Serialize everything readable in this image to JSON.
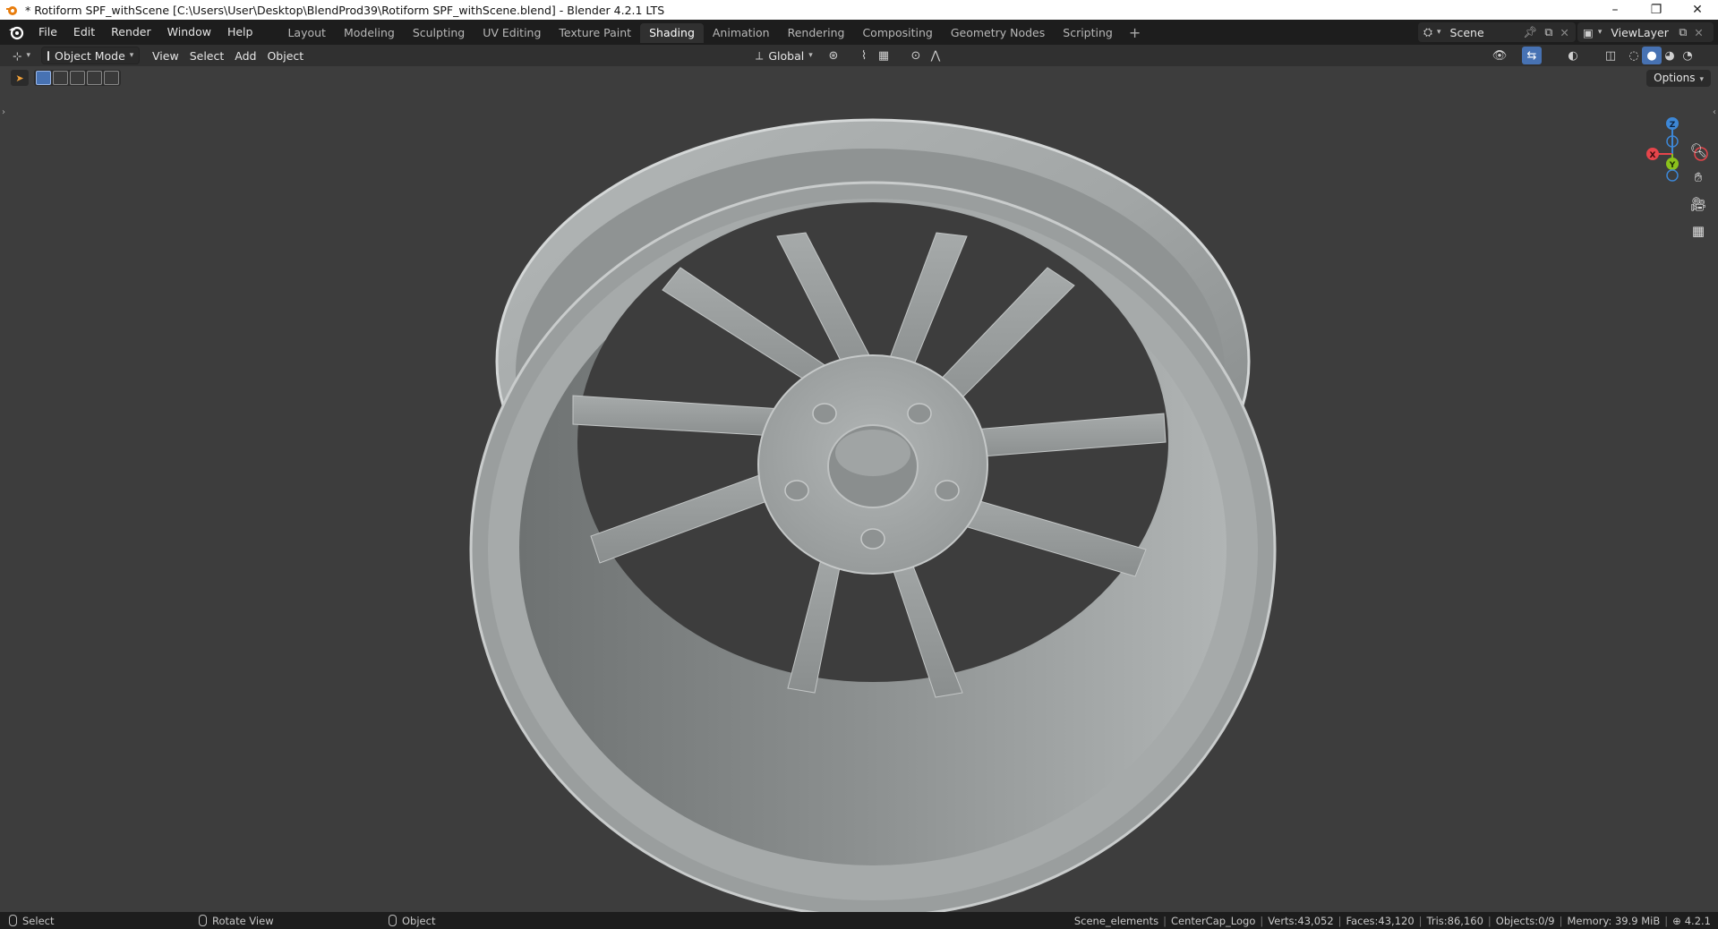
{
  "window": {
    "title": "* Rotiform SPF_withScene [C:\\Users\\User\\Desktop\\BlendProd39\\Rotiform SPF_withScene.blend] - Blender 4.2.1 LTS",
    "minimize": "–",
    "restore": "❐",
    "close": "✕"
  },
  "menu": [
    "File",
    "Edit",
    "Render",
    "Window",
    "Help"
  ],
  "workspaces": [
    "Layout",
    "Modeling",
    "Sculpting",
    "UV Editing",
    "Texture Paint",
    "Shading",
    "Animation",
    "Rendering",
    "Compositing",
    "Geometry Nodes",
    "Scripting"
  ],
  "active_workspace": "Shading",
  "add_workspace": "+",
  "scene": {
    "name": "Scene"
  },
  "view_layer": {
    "name": "ViewLayer"
  },
  "viewport_header": {
    "mode": "Object Mode",
    "menus": [
      "View",
      "Select",
      "Add",
      "Object"
    ],
    "transform_orientation": "Global"
  },
  "viewport": {
    "options_label": "Options",
    "background_color": "#3d3d3d",
    "gizmo": {
      "z": "Z",
      "y": "Y",
      "x": "X"
    }
  },
  "statusbar": {
    "hints": [
      "Select",
      "Rotate View",
      "Object"
    ],
    "info": [
      "Scene_elements",
      "CenterCap_Logo",
      "Verts:43,052",
      "Faces:43,120",
      "Tris:86,160",
      "Objects:0/9",
      "Memory: 39.9 MiB",
      "4.2.1"
    ]
  },
  "colors": {
    "accent": "#4772b3",
    "axis_x": "#e6454b",
    "axis_y": "#8bc21c",
    "axis_z": "#3d87d6",
    "wheel": "#9ea2a2"
  }
}
